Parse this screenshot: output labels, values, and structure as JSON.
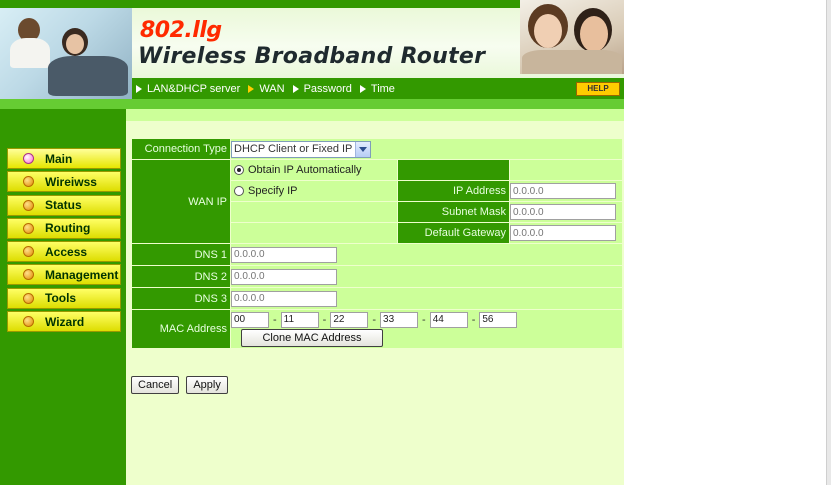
{
  "header": {
    "model": "802.llg",
    "title": "Wireless Broadband Router"
  },
  "nav": {
    "items": [
      {
        "label": "LAN&DHCP server",
        "active": false
      },
      {
        "label": "WAN",
        "active": true
      },
      {
        "label": "Password",
        "active": false
      },
      {
        "label": "Time",
        "active": false
      }
    ],
    "help_label": "HELP"
  },
  "sidebar": {
    "items": [
      {
        "label": "Main",
        "active": true
      },
      {
        "label": "Wireiwss",
        "active": false
      },
      {
        "label": "Status",
        "active": false
      },
      {
        "label": "Routing",
        "active": false
      },
      {
        "label": "Access",
        "active": false
      },
      {
        "label": "Management",
        "active": false
      },
      {
        "label": "Tools",
        "active": false
      },
      {
        "label": "Wizard",
        "active": false
      }
    ]
  },
  "form": {
    "connection_type": {
      "label": "Connection Type",
      "selected": "DHCP Client or Fixed IP"
    },
    "wan_ip": {
      "label": "WAN IP",
      "option_auto": "Obtain IP Automatically",
      "option_specify": "Specify IP",
      "selected": "auto",
      "ip_address": {
        "label": "IP Address",
        "placeholder": "0.0.0.0"
      },
      "subnet_mask": {
        "label": "Subnet Mask",
        "placeholder": "0.0.0.0"
      },
      "default_gateway": {
        "label": "Default Gateway",
        "placeholder": "0.0.0.0"
      }
    },
    "dns1": {
      "label": "DNS 1",
      "placeholder": "0.0.0.0"
    },
    "dns2": {
      "label": "DNS 2",
      "placeholder": "0.0.0.0"
    },
    "dns3": {
      "label": "DNS 3",
      "placeholder": "0.0.0.0"
    },
    "mac": {
      "label": "MAC Address",
      "octets": [
        "00",
        "11",
        "22",
        "33",
        "44",
        "56"
      ],
      "separator": "-",
      "clone_label": "Clone MAC Address"
    }
  },
  "actions": {
    "cancel_label": "Cancel",
    "apply_label": "Apply"
  },
  "colors": {
    "dark_green": "#339900",
    "light_green": "#ccff99",
    "pale_green": "#eeffcc",
    "menu_yellow": "#ffff66",
    "brand_red": "#ff2a00"
  }
}
